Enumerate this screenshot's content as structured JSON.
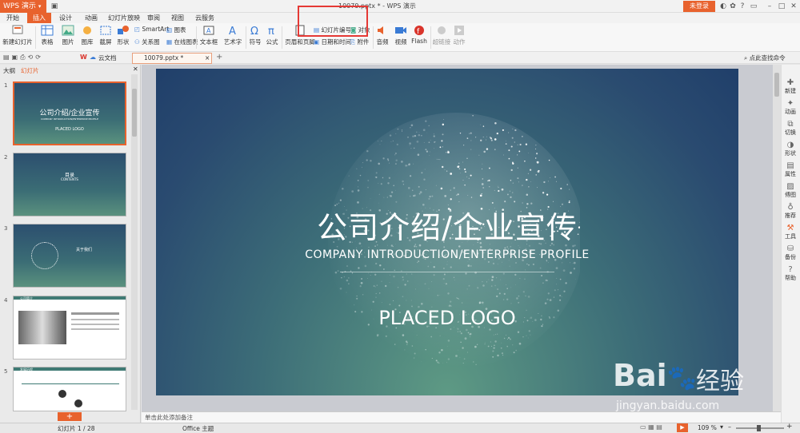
{
  "titlebar": {
    "app_label": "WPS 演示",
    "window_title": "10079.pptx * - WPS 演示",
    "login": "未登录"
  },
  "tabs": [
    "开始",
    "插入",
    "设计",
    "动画",
    "幻灯片放映",
    "审阅",
    "视图",
    "云服务"
  ],
  "active_tab": "插入",
  "ribbon": {
    "new_slide": "新建幻灯片",
    "table": "表格",
    "picture": "图片",
    "shape_fill": "图库",
    "screenshot": "截屏",
    "shapes": "形状",
    "smartart": "SmartArt",
    "chart": "图表",
    "relation": "关系图",
    "online_chart": "在线图表",
    "textbox": "文本框",
    "wordart": "艺术字",
    "symbol": "符号",
    "formula": "公式",
    "header_footer": "页眉和页脚",
    "slide_number": "幻灯片编号",
    "object": "对象",
    "datetime": "日期和时间",
    "attachment": "附件",
    "audio": "音频",
    "video": "视频",
    "flash": "Flash",
    "hyperlink": "超链接",
    "action": "动作"
  },
  "toolbar2": {
    "cloud_doc": "云文档",
    "doc_tab": "10079.pptx *",
    "search_cmd": "点此查找命令"
  },
  "leftpanel": {
    "tab_outline": "大纲",
    "tab_slides": "幻灯片",
    "thumbs": [
      {
        "num": "1",
        "title": "公司介绍/企业宣传",
        "sub": "COMPANY INTRODUCTION/ENTERPRISE PROFILE",
        "logo": "PLACED LOGO"
      },
      {
        "num": "2",
        "title": "目录",
        "sub": "CONTENTS"
      },
      {
        "num": "3",
        "title": "关于我们"
      },
      {
        "num": "4",
        "title": "公司简介"
      },
      {
        "num": "5",
        "title": "发展历程"
      }
    ],
    "add": "+"
  },
  "slide": {
    "title": "公司介绍/企业宣传",
    "subtitle": "COMPANY INTRODUCTION/ENTERPRISE PROFILE",
    "logo": "PLACED LOGO"
  },
  "rightpanel": [
    "新建",
    "动画",
    "切换",
    "形状",
    "属性",
    "傅图",
    "推荐",
    "工具",
    "备份",
    "帮助"
  ],
  "notes_placeholder": "单击此处添加备注",
  "status": {
    "slide_count": "幻灯片 1 / 28",
    "theme": "Office 主题",
    "zoom": "109 %"
  },
  "watermark": {
    "brand": "Bai",
    "brand_cn": "经验",
    "url": "jingyan.baidu.com"
  },
  "colors": {
    "accent": "#e8622d",
    "highlight_box": "#e53935"
  }
}
